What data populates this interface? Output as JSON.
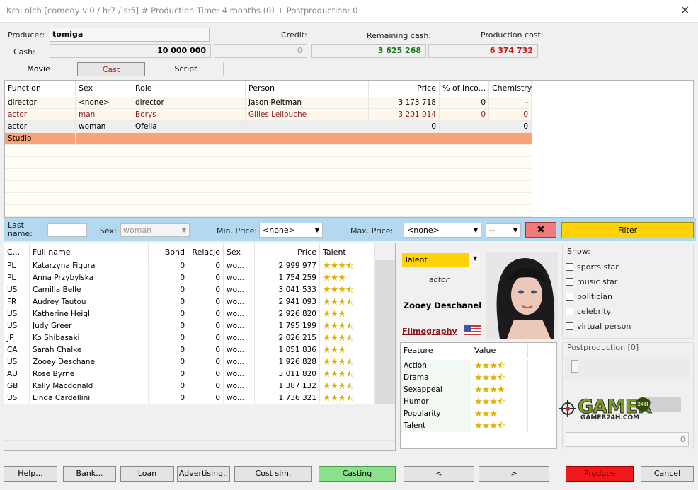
{
  "window": {
    "title": "Krol olch [comedy v:0 / h:7 / s:5] # Production Time: 4  months (0) + Postproduction: 0",
    "close": "✕"
  },
  "top": {
    "producer_label": "Producer:",
    "producer": "tomiga",
    "cash_label": "Cash:",
    "cash": "10 000 000",
    "credit_label": "Credit:",
    "credit": "0",
    "remaining_label": "Remaining cash:",
    "remaining": "3 625 268",
    "cost_label": "Production cost:",
    "cost": "6 374 732"
  },
  "tabs": [
    "Movie",
    "Cast",
    "Script"
  ],
  "cast": {
    "headers": [
      "Function",
      "Sex",
      "Role",
      "Person",
      "Price",
      "% of inco...",
      "Chemistry"
    ],
    "rows": [
      [
        "director",
        "<none>",
        "director",
        "Jason Reitman",
        "3 173 718",
        "0",
        "-"
      ],
      [
        "actor",
        "man",
        "Borys",
        "Gilles Lellouche",
        "3 201 014",
        "0",
        "0"
      ],
      [
        "actor",
        "woman",
        "Ofelia",
        "",
        "0",
        "",
        "0"
      ],
      [
        "Studio",
        "",
        "",
        "",
        "",
        "",
        ""
      ]
    ]
  },
  "filter": {
    "last_name_label": "Last name:",
    "last_name": "",
    "sex_label": "Sex:",
    "sex": "woman",
    "min_label": "Min. Price:",
    "min": "<none>",
    "max_label": "Max. Price:",
    "max": "<none>",
    "extra": "--",
    "clear": "✖",
    "filter_btn": "Filter"
  },
  "people": {
    "headers": [
      "C...",
      "Full name",
      "Bond",
      "Relacje",
      "Sex",
      "Price",
      "Talent"
    ],
    "rows": [
      {
        "c": "PL",
        "name": "Katarzyna Figura",
        "bond": "0",
        "rel": "0",
        "sex": "wo...",
        "price": "2 999 977",
        "talent": 3.5
      },
      {
        "c": "PL",
        "name": "Anna Przybylska",
        "bond": "0",
        "rel": "0",
        "sex": "wo...",
        "price": "1 754 259",
        "talent": 3
      },
      {
        "c": "US",
        "name": "Camilla Belle",
        "bond": "0",
        "rel": "0",
        "sex": "wo...",
        "price": "3 041 533",
        "talent": 3.5
      },
      {
        "c": "FR",
        "name": "Audrey Tautou",
        "bond": "0",
        "rel": "0",
        "sex": "wo...",
        "price": "2 941 093",
        "talent": 3.5
      },
      {
        "c": "US",
        "name": "Katherine Heigl",
        "bond": "0",
        "rel": "0",
        "sex": "wo...",
        "price": "2 926 820",
        "talent": 3
      },
      {
        "c": "US",
        "name": "Judy Greer",
        "bond": "0",
        "rel": "0",
        "sex": "wo...",
        "price": "1 795 199",
        "talent": 3.5
      },
      {
        "c": "JP",
        "name": "Ko Shibasaki",
        "bond": "0",
        "rel": "0",
        "sex": "wo...",
        "price": "2 026 215",
        "talent": 3.5
      },
      {
        "c": "CA",
        "name": "Sarah Chalke",
        "bond": "0",
        "rel": "0",
        "sex": "wo...",
        "price": "1 051 836",
        "talent": 3
      },
      {
        "c": "US",
        "name": "Zooey Deschanel",
        "bond": "0",
        "rel": "0",
        "sex": "wo...",
        "price": "1 926 828",
        "talent": 3.5
      },
      {
        "c": "AU",
        "name": "Rose Byrne",
        "bond": "0",
        "rel": "0",
        "sex": "wo...",
        "price": "3 011 820",
        "talent": 3.5
      },
      {
        "c": "GB",
        "name": "Kelly Macdonald",
        "bond": "0",
        "rel": "0",
        "sex": "wo...",
        "price": "1 387 132",
        "talent": 3.5
      },
      {
        "c": "US",
        "name": "Linda Cardellini",
        "bond": "0",
        "rel": "0",
        "sex": "wo...",
        "price": "1 736 321",
        "talent": 3.5
      }
    ]
  },
  "detail": {
    "sort": "Talent",
    "function": "actor",
    "name": "Zooey Deschanel",
    "filmography": "Filmography",
    "feat_header": "Feature",
    "val_header": "Value",
    "features": [
      {
        "name": "Action",
        "v": 3.5
      },
      {
        "name": "Drama",
        "v": 3.5
      },
      {
        "name": "Sexappeal",
        "v": 4
      },
      {
        "name": "Humor",
        "v": 3.5
      },
      {
        "name": "Popularity",
        "v": 3
      },
      {
        "name": "Talent",
        "v": 3.5
      }
    ]
  },
  "show": {
    "label": "Show:",
    "items": [
      "sports star",
      "music star",
      "politician",
      "celebrity",
      "virtual person"
    ]
  },
  "post": {
    "label": "Postproduction [0]",
    "value": "0",
    "watermark": "GAMER",
    "watermark_sub": "GAMER24H.COM",
    "badge": "24H"
  },
  "buttons": [
    "Help...",
    "Bank...",
    "Loan",
    "Advertising..",
    "Cost sim.",
    "Casting",
    "<",
    ">",
    "Produce",
    "Cancel"
  ]
}
